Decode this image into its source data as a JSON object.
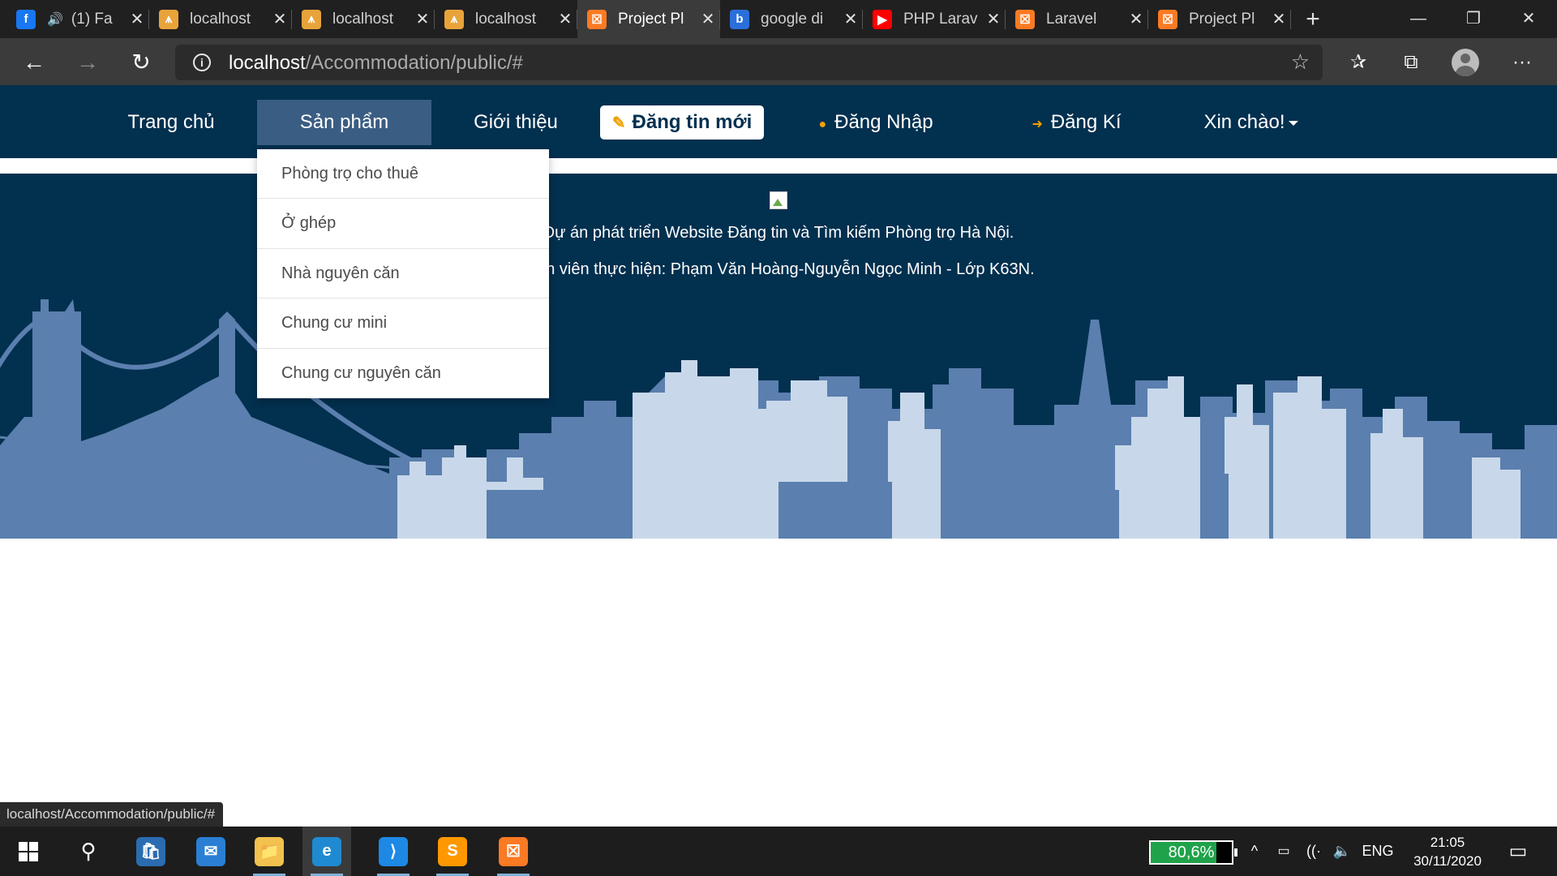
{
  "browser": {
    "tabs": [
      {
        "title": "(1) Fa",
        "icon": "facebook-icon",
        "color": "#1877f2",
        "glyph": "f",
        "muted_icon": "🔊",
        "active": false
      },
      {
        "title": "localhost",
        "icon": "phpmyadmin-icon",
        "color": "#e8a33a",
        "glyph": "⩚",
        "active": false
      },
      {
        "title": "localhost",
        "icon": "phpmyadmin-icon",
        "color": "#e8a33a",
        "glyph": "⩚",
        "active": false
      },
      {
        "title": "localhost",
        "icon": "phpmyadmin-icon",
        "color": "#e8a33a",
        "glyph": "⩚",
        "active": false
      },
      {
        "title": "Project Pl",
        "icon": "xampp-icon",
        "color": "#fb7a24",
        "glyph": "☒",
        "active": true
      },
      {
        "title": "google di",
        "icon": "bing-icon",
        "color": "#2a6fdb",
        "glyph": "b",
        "active": false
      },
      {
        "title": "PHP Larav",
        "icon": "youtube-icon",
        "color": "#ff0000",
        "glyph": "▶",
        "active": false
      },
      {
        "title": "Laravel",
        "icon": "xampp-icon",
        "color": "#fb7a24",
        "glyph": "☒",
        "active": false
      },
      {
        "title": "Project Pl",
        "icon": "xampp-icon",
        "color": "#fb7a24",
        "glyph": "☒",
        "active": false
      }
    ],
    "tab_close_glyph": "✕",
    "new_tab_glyph": "+",
    "window_controls": {
      "minimize": "—",
      "restore": "❐",
      "close": "✕"
    },
    "url_host": "localhost",
    "url_path": "/Accommodation/public/#",
    "info_glyph": "i",
    "star_glyph": "☆",
    "back_glyph": "←",
    "forward_glyph": "→",
    "refresh_glyph": "↻",
    "favorites_glyph": "✰",
    "collections_glyph": "⧉",
    "more_glyph": "···"
  },
  "site": {
    "nav": {
      "home": "Trang chủ",
      "products": "Sản phẩm",
      "about": "Giới thiệu",
      "post_new": "Đăng tin mới",
      "post_icon_glyph": "✎",
      "login": "Đăng Nhập",
      "login_icon_glyph": "●",
      "register": "Đăng Kí",
      "register_icon_glyph": "➜",
      "greeting": "Xin chào!"
    },
    "products_menu": [
      "Phòng trọ cho thuê",
      "Ở ghép",
      "Nhà nguyên căn",
      "Chung cư mini",
      "Chung cư nguyên căn"
    ],
    "hero": {
      "line1": "Dự án phát triển Website Đăng tin và Tìm kiếm Phòng trọ Hà Nội.",
      "line2": "Sinh viên thực hiện: Phạm Văn Hoàng-Nguyễn Ngọc Minh - Lớp K63N."
    },
    "colors": {
      "navbar": "#02304f",
      "active_nav": "#3a5d83",
      "skyline_back": "#5b7fae",
      "skyline_front": "#c8d8ea",
      "accent": "#f0a000"
    }
  },
  "status_url": "localhost/Accommodation/public/#",
  "taskbar": {
    "apps": [
      {
        "name": "store-icon",
        "glyph": "🛍",
        "color": "#2b6cb0"
      },
      {
        "name": "mail-icon",
        "glyph": "✉",
        "color": "#2a7fd4"
      },
      {
        "name": "file-explorer-icon",
        "glyph": "📁",
        "color": "#f2c14e"
      },
      {
        "name": "edge-icon",
        "glyph": "e",
        "color": "#1f8ad1"
      },
      {
        "name": "vscode-icon",
        "glyph": "⟩",
        "color": "#1e88e5"
      },
      {
        "name": "sublime-icon",
        "glyph": "S",
        "color": "#ff9800"
      },
      {
        "name": "xampp-icon",
        "glyph": "☒",
        "color": "#fb7a24"
      }
    ],
    "battery_text": "80,6%",
    "battery_level": 0.806,
    "chevron_glyph": "^",
    "network_glyph": "((·",
    "volume_glyph": "🔈",
    "language": "ENG",
    "time": "21:05",
    "date": "30/11/2020",
    "notification_glyph": "▭"
  }
}
